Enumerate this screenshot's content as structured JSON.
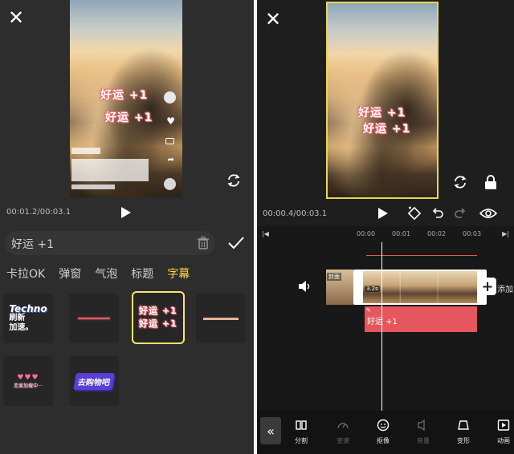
{
  "left": {
    "preview": {
      "subtitle_line1": "好运 +1",
      "subtitle_line2": "好运 +1"
    },
    "time": "00:01.2/00:03.1",
    "input": {
      "value": "好运 +1"
    },
    "tabs": [
      {
        "label": "卡拉OK"
      },
      {
        "label": "弹窗"
      },
      {
        "label": "气泡"
      },
      {
        "label": "标题"
      },
      {
        "label": "字幕",
        "active": true
      }
    ],
    "tiles": {
      "techno": {
        "line1": "Techno",
        "line2": "刷新",
        "line3": "加速。"
      },
      "lucky": {
        "line1": "好运 +1",
        "line2": "好运 +1"
      },
      "loading": {
        "text": "恋爱加载中···"
      },
      "shopping": {
        "text": "去购物吧"
      }
    }
  },
  "right": {
    "preview": {
      "subtitle_line1": "好运 +1",
      "subtitle_line2": "好运 +1"
    },
    "time": "00:00.4/00:03.1",
    "ruler": [
      "00:00",
      "00:01",
      "00:02",
      "00:03"
    ],
    "track": {
      "cover_label": "封面",
      "duration": "3.2s",
      "add_label": "添加"
    },
    "subtitle_clip": {
      "text": "好运 +1"
    },
    "toolbar": [
      {
        "label": "分割",
        "icon": "split-icon",
        "enabled": true
      },
      {
        "label": "变速",
        "icon": "speed-icon",
        "enabled": false
      },
      {
        "label": "抠像",
        "icon": "cutout-icon",
        "enabled": true
      },
      {
        "label": "音量",
        "icon": "volume-icon",
        "enabled": false
      },
      {
        "label": "变形",
        "icon": "transform-icon",
        "enabled": true
      },
      {
        "label": "动画",
        "icon": "animation-icon",
        "enabled": true
      }
    ]
  },
  "colors": {
    "accent_yellow": "#ffd93d",
    "clip_red": "#e5565d",
    "selection_border": "#e6d94a"
  }
}
